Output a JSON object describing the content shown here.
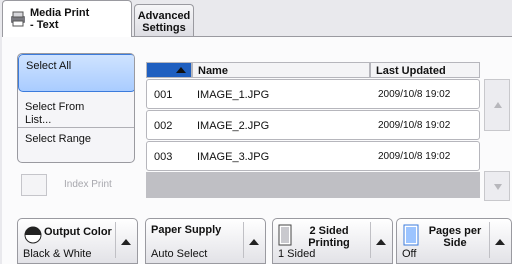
{
  "tabs": [
    {
      "label": "Media Print\n- Text",
      "active": true
    },
    {
      "label": "Advanced\nSettings",
      "active": false
    }
  ],
  "selection": {
    "select_all": "Select All",
    "select_from_list": "Select From\nList...",
    "select_range": "Select Range"
  },
  "index_print": {
    "label": "Index Print",
    "enabled": false
  },
  "table": {
    "headers": {
      "name": "Name",
      "last_updated": "Last Updated"
    },
    "sorted_column": "number",
    "sort_direction": "ascending",
    "rows": [
      {
        "num": "001",
        "name": "IMAGE_1.JPG",
        "updated": "2009/10/8 19:02"
      },
      {
        "num": "002",
        "name": "IMAGE_2.JPG",
        "updated": "2009/10/8 19:02"
      },
      {
        "num": "003",
        "name": "IMAGE_3.JPG",
        "updated": "2009/10/8 19:02"
      }
    ]
  },
  "options": [
    {
      "title": "Output Color",
      "value": "Black & White",
      "icon": "color-wheel-icon"
    },
    {
      "title": "Paper Supply",
      "value": "Auto Select",
      "icon": ""
    },
    {
      "title": "2 Sided\nPrinting",
      "value": "1 Sided",
      "icon": "page-icon"
    },
    {
      "title": "Pages per\nSide",
      "value": "Off",
      "icon": "page-icon"
    }
  ],
  "colors": {
    "accent": "#1f5fc0",
    "selected_bg": "#a9ccff",
    "panel_bg": "#fbfbfc",
    "disabled_text": "#a7a7ad"
  }
}
